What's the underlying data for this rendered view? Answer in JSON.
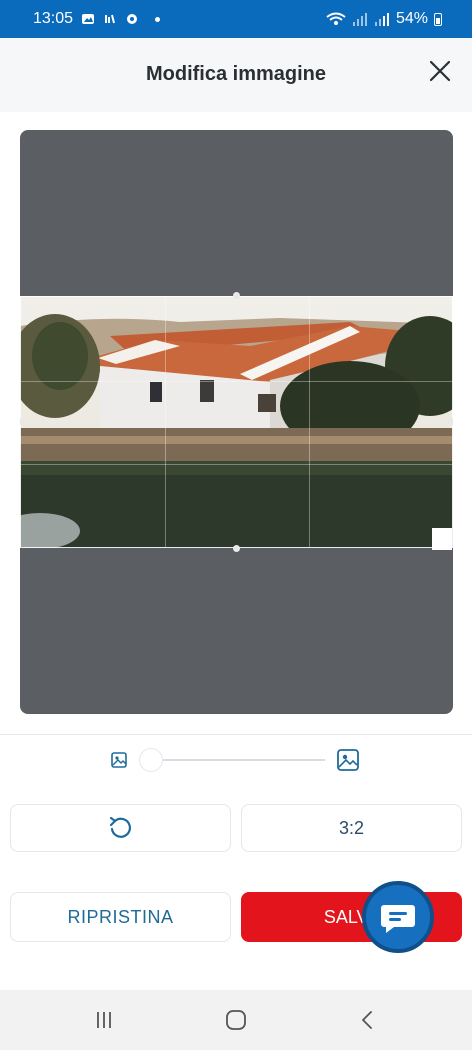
{
  "status_bar": {
    "time": "13:05",
    "battery": "54%"
  },
  "header": {
    "title": "Modifica immagine"
  },
  "icons": {
    "close": "close-icon",
    "zoom_out": "image-small-icon",
    "zoom_in": "image-large-icon",
    "rotate": "rotate-left-icon",
    "chat": "chat-icon"
  },
  "controls": {
    "zoom_level": 0,
    "aspect_ratio_label": "3:2",
    "reset_label": "RIPRISTINA",
    "save_label": "SALVA"
  },
  "colors": {
    "status_bar": "#0a6bbd",
    "save_button": "#e3141b",
    "accent": "#1e6b9a",
    "editor_bg": "#5b5e63",
    "chat_fab": "#1670bf"
  }
}
